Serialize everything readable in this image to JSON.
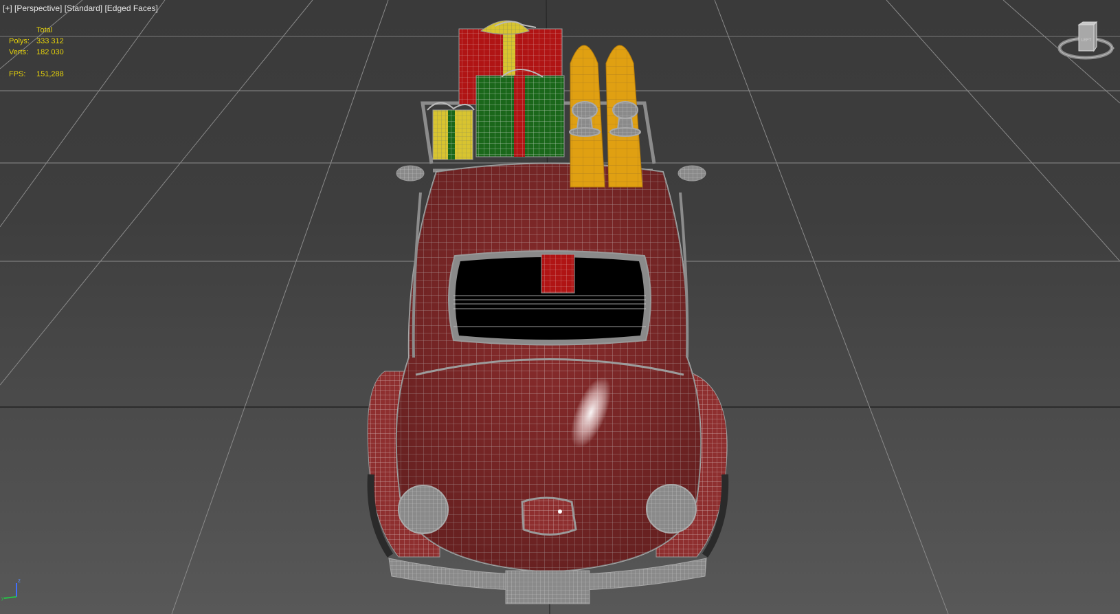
{
  "viewport": {
    "labels": [
      "[+]",
      "[Perspective]",
      "[Standard]",
      "[Edged Faces]"
    ]
  },
  "stats": {
    "header": "Total",
    "polys_label": "Polys:",
    "polys_value": "333 312",
    "verts_label": "Verts:",
    "verts_value": "182 030",
    "fps_label": "FPS:",
    "fps_value": "151,288"
  },
  "viewcube": {
    "face_label": "LEFT"
  },
  "axis_gizmo": {
    "z": "z",
    "y": "y"
  },
  "colors": {
    "car_body": "#8c2e2e",
    "wire": "#c9c9c9",
    "gift_red": "#b01414",
    "gift_green": "#1c6a1c",
    "gift_yellow": "#d8c430",
    "skis": "#e0a012",
    "stats_text": "#e8d40a",
    "grid_line": "#8a8a8a"
  }
}
